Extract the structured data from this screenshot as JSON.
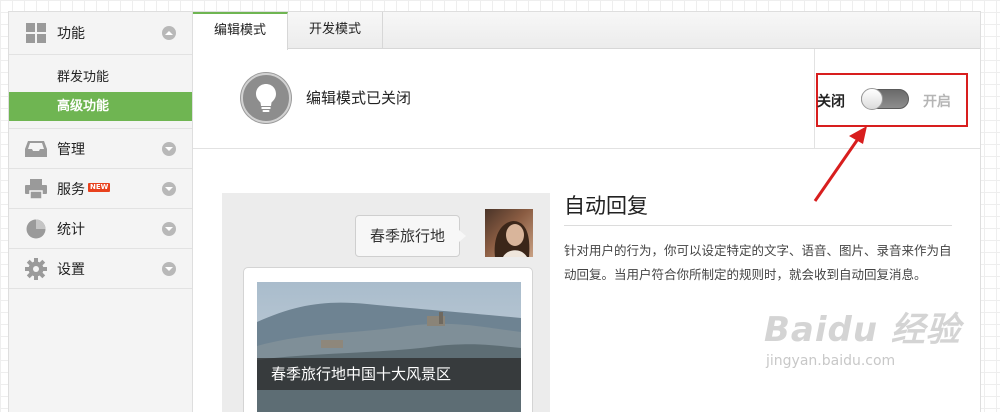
{
  "sidebar": {
    "function": {
      "label": "功能",
      "icon": "grid-icon"
    },
    "function_items": [
      {
        "label": "群发功能"
      },
      {
        "label": "高级功能"
      }
    ],
    "manage": {
      "label": "管理",
      "icon": "inbox-icon"
    },
    "service": {
      "label": "服务",
      "badge": "NEW",
      "icon": "printer-icon"
    },
    "stats": {
      "label": "统计",
      "icon": "pie-chart-icon"
    },
    "settings": {
      "label": "设置",
      "icon": "gear-icon"
    }
  },
  "tabs": [
    {
      "label": "编辑模式"
    },
    {
      "label": "开发模式"
    }
  ],
  "status": {
    "text": "编辑模式已关闭",
    "off_label": "关闭",
    "on_label": "开启",
    "enabled": false
  },
  "preview": {
    "bubble_text": "春季旅行地",
    "article_caption": "春季旅行地中国十大风景区"
  },
  "info": {
    "title": "自动回复",
    "description": "针对用户的行为，你可以设定特定的文字、语音、图片、录音来作为自动回复。当用户符合你所制定的规则时，就会收到自动回复消息。"
  },
  "watermark": {
    "brand": "Baidu 经验",
    "url": "jingyan.baidu.com"
  },
  "colors": {
    "accent_green": "#6fb552",
    "highlight_red": "#d81e1e",
    "badge_red": "#e8411d"
  }
}
